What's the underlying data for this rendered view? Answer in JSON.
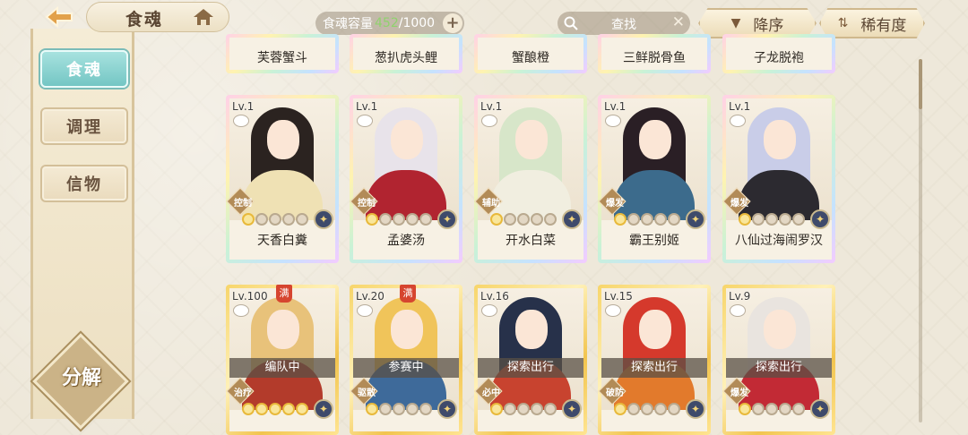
{
  "header": {
    "title": "食魂",
    "capacity_label": "食魂容量",
    "capacity_current": "452",
    "capacity_max": "/1000",
    "search_label": "查找",
    "sort_order": "降序",
    "sort_rarity": "稀有度"
  },
  "sidebar": {
    "tabs": [
      {
        "label": "食魂",
        "active": true
      },
      {
        "label": "调理",
        "active": false
      },
      {
        "label": "信物",
        "active": false
      }
    ],
    "decompose": "分解"
  },
  "top_row": [
    {
      "name": "芙蓉蟹斗"
    },
    {
      "name": "葱扒虎头鲤"
    },
    {
      "name": "蟹酿橙"
    },
    {
      "name": "三鲜脱骨鱼"
    },
    {
      "name": "子龙脱袍"
    }
  ],
  "mid_row": [
    {
      "level": "Lv.1",
      "role": "控制",
      "name": "天香白糞",
      "hair": "#2b2320",
      "outfit": "#efe1b4"
    },
    {
      "level": "Lv.1",
      "role": "控制",
      "name": "孟婆汤",
      "hair": "#e8e3ea",
      "outfit": "#b12430"
    },
    {
      "level": "Lv.1",
      "role": "辅助",
      "name": "开水白菜",
      "hair": "#d7e6c9",
      "outfit": "#f1eee0"
    },
    {
      "level": "Lv.1",
      "role": "爆发",
      "name": "霸王别姬",
      "hair": "#2a1f25",
      "outfit": "#3c6b8c"
    },
    {
      "level": "Lv.1",
      "role": "爆发",
      "name": "八仙过海闹罗汉",
      "hair": "#c9cde8",
      "outfit": "#2c2a30"
    }
  ],
  "bottom_row": [
    {
      "level": "Lv.100",
      "full": "满",
      "status": "编队中",
      "role": "治疗",
      "hair": "#e8c27a",
      "outfit": "#b33b2b"
    },
    {
      "level": "Lv.20",
      "full": "满",
      "status": "参赛中",
      "role": "驱散",
      "hair": "#f0c45a",
      "outfit": "#3e6a9a"
    },
    {
      "level": "Lv.16",
      "status": "探索出行",
      "role": "必中",
      "hair": "#27314a",
      "outfit": "#c8432f"
    },
    {
      "level": "Lv.15",
      "status": "探索出行",
      "role": "破防",
      "hair": "#d5392c",
      "outfit": "#e27a2c"
    },
    {
      "level": "Lv.9",
      "status": "探索出行",
      "role": "爆发",
      "hair": "#e9e4df",
      "outfit": "#c22a35"
    }
  ]
}
